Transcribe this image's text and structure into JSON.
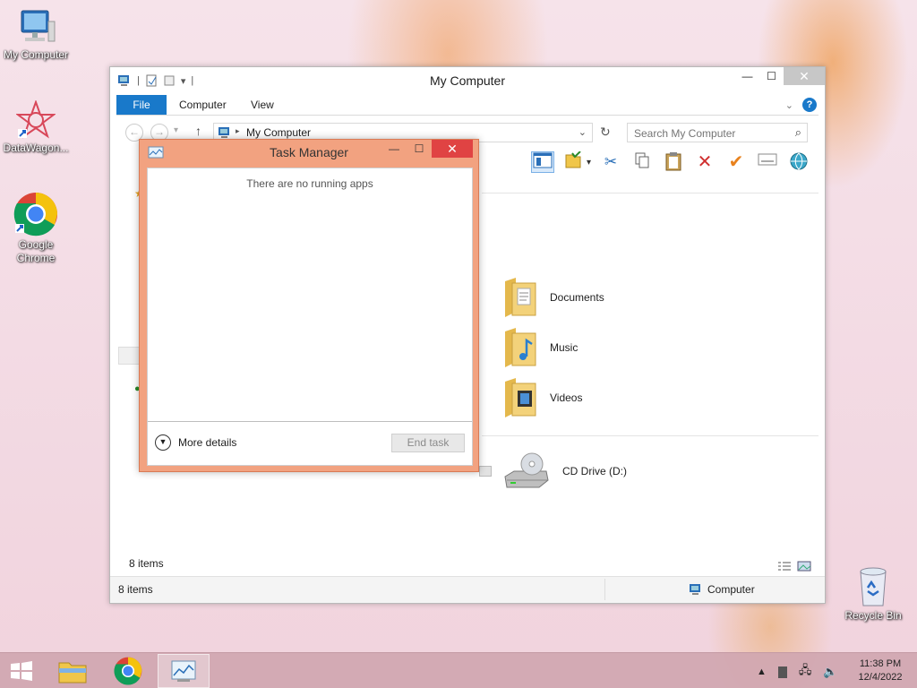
{
  "desktop": {
    "icons": [
      {
        "label": "My Computer"
      },
      {
        "label": "DataWagon..."
      },
      {
        "label": "Google Chrome"
      },
      {
        "label": "Recycle Bin"
      }
    ]
  },
  "explorer": {
    "title": "My Computer",
    "tabs": {
      "file": "File",
      "computer": "Computer",
      "view": "View"
    },
    "address": "My Computer",
    "search_placeholder": "Search My Computer",
    "items": [
      {
        "label": "Documents",
        "icon": "documents-folder-icon"
      },
      {
        "label": "Music",
        "icon": "music-folder-icon"
      },
      {
        "label": "Videos",
        "icon": "videos-folder-icon"
      },
      {
        "label": "CD Drive (D:)",
        "icon": "cd-drive-icon"
      }
    ],
    "items_count": "8 items",
    "status": {
      "count": "8 items",
      "location": "Computer"
    }
  },
  "taskmgr": {
    "title": "Task Manager",
    "empty_message": "There are no running apps",
    "more_details": "More details",
    "end_task": "End task"
  },
  "taskbar": {
    "clock_time": "11:38 PM",
    "clock_date": "12/4/2022"
  }
}
